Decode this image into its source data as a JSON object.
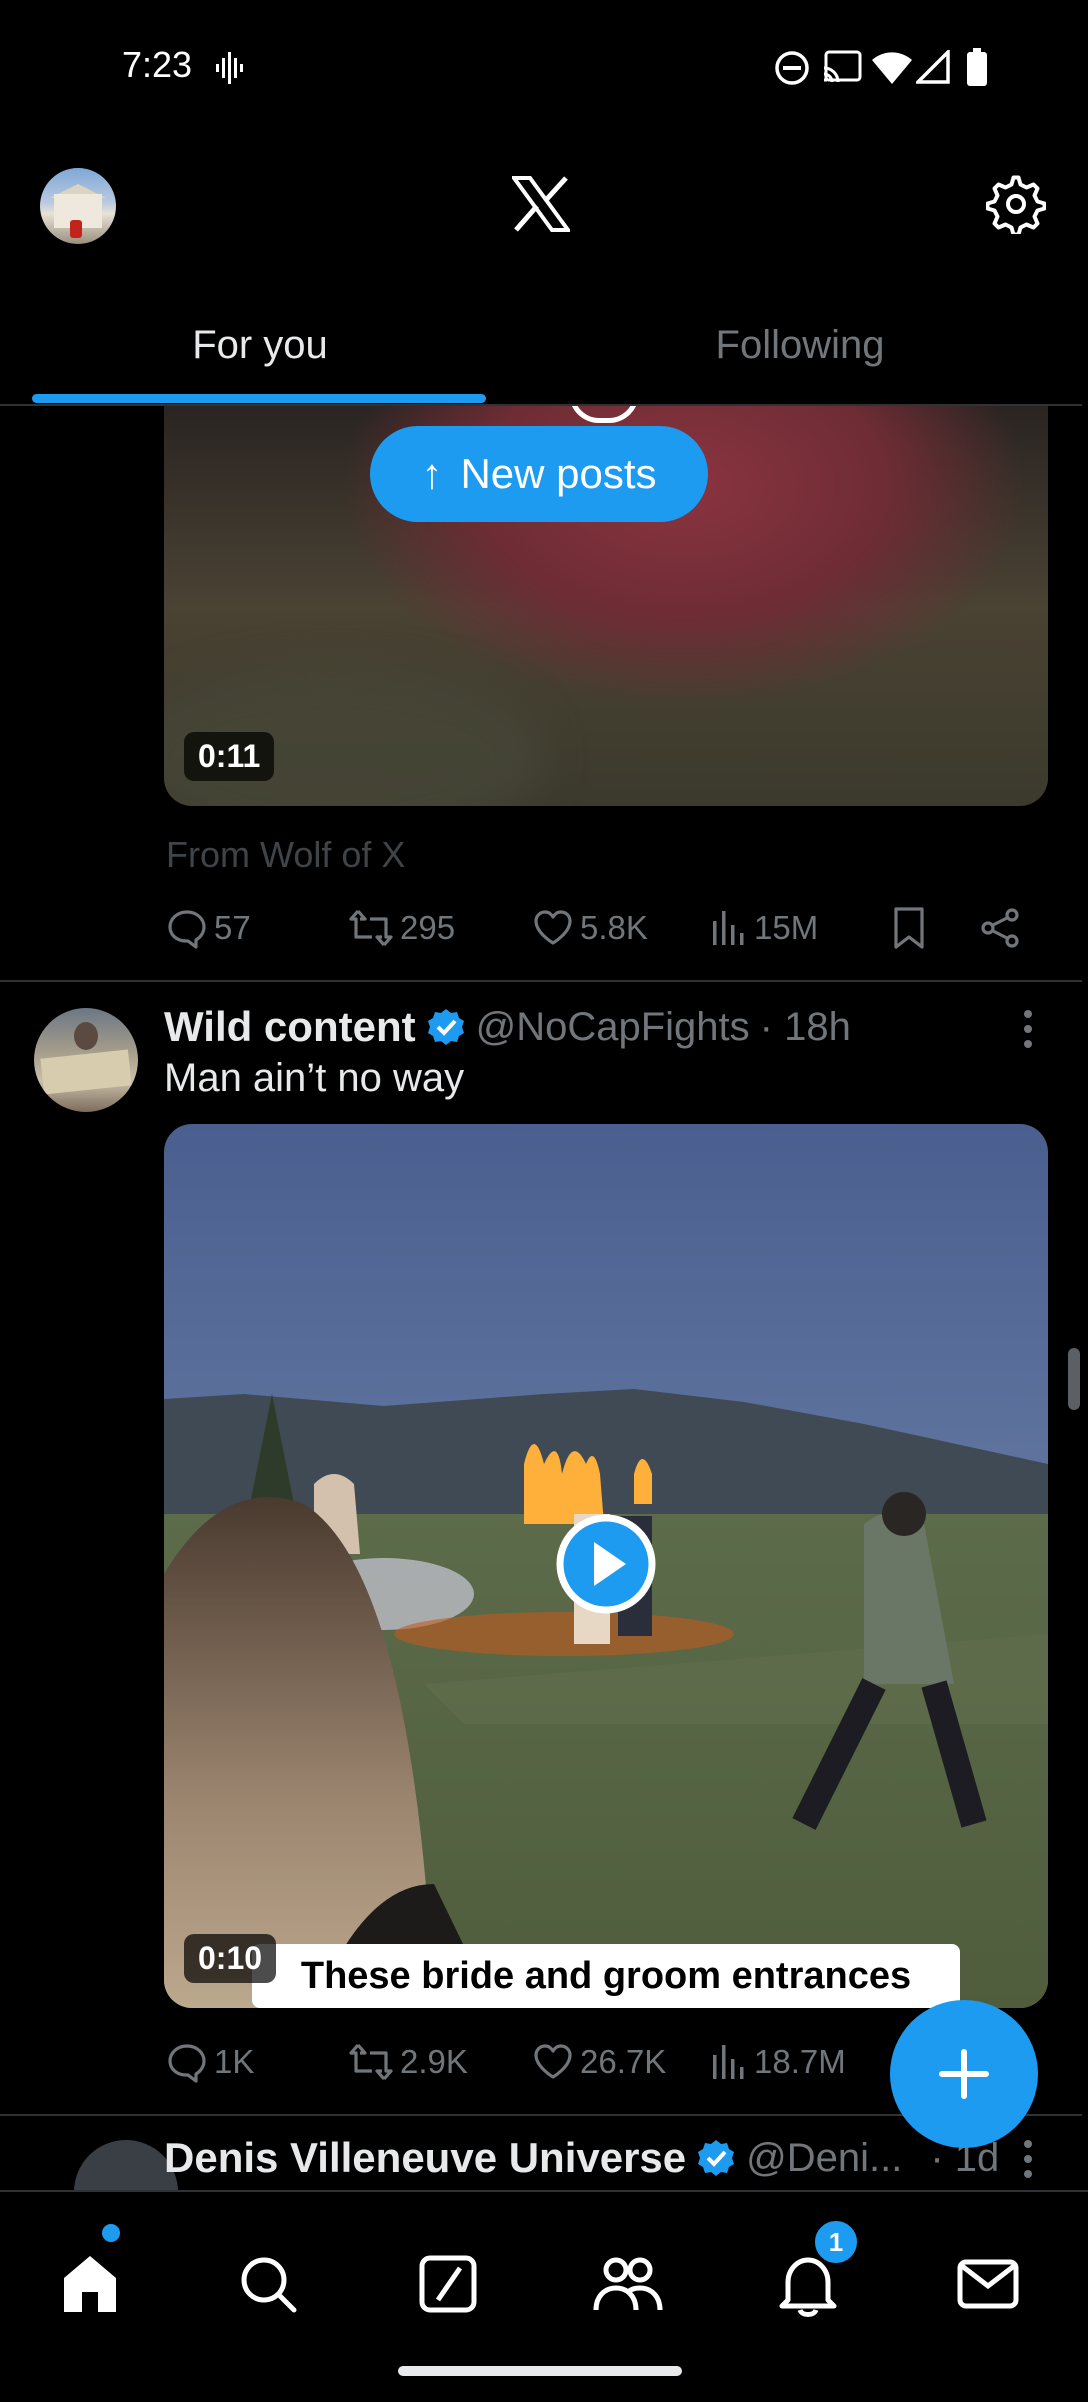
{
  "status_bar": {
    "time": "7:23"
  },
  "header": {
    "logo": "X",
    "avatar_icon": "profile-avatar",
    "settings_icon": "gear-icon"
  },
  "tabs": [
    {
      "label": "For you",
      "active": true
    },
    {
      "label": "Following",
      "active": false
    }
  ],
  "new_posts_pill": {
    "label": "New posts"
  },
  "post1": {
    "duration": "0:11",
    "attribution": "From Wolf of X",
    "replies": "57",
    "reposts": "295",
    "likes": "5.8K",
    "views": "15M"
  },
  "post2": {
    "author": "Wild content",
    "handle": "@NoCapFights",
    "time": "· 18h",
    "text": "Man ain’t no way",
    "duration": "0:10",
    "caption": "These bride and groom entrances",
    "replies": "1K",
    "reposts": "2.9K",
    "likes": "26.7K",
    "views": "18.7M"
  },
  "post3": {
    "author": "Denis Villeneuve Universe",
    "handle": "@Deni...",
    "time": "· 1d"
  },
  "fab": {
    "icon": "plus-icon"
  },
  "bottom_nav": {
    "items": [
      "home-icon",
      "search-icon",
      "grok-icon",
      "communities-icon",
      "notifications-icon",
      "messages-icon"
    ],
    "notifications_badge": "1"
  },
  "colors": {
    "accent": "#1d9bf0",
    "background": "#000000",
    "muted": "#71767b",
    "verified": "#1d9bf0"
  }
}
